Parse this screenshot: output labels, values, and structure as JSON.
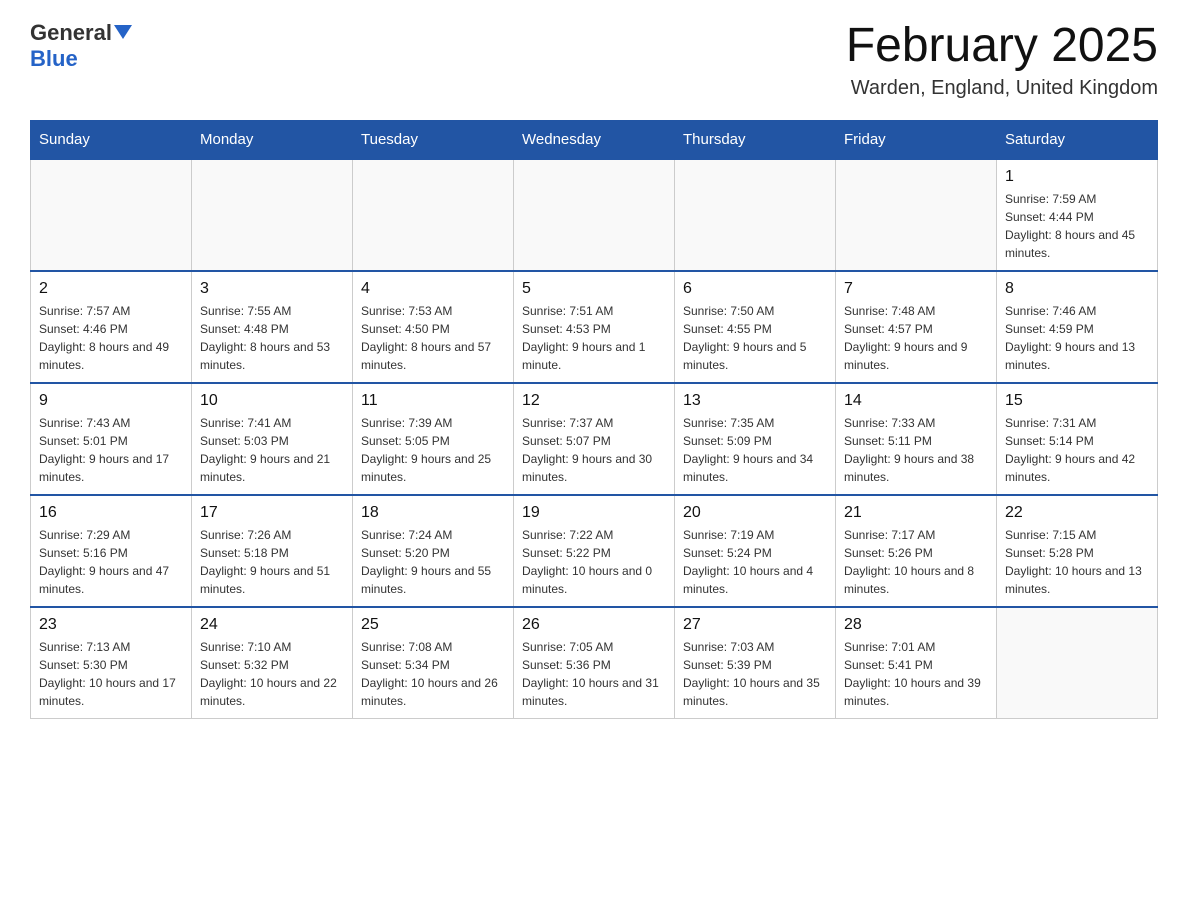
{
  "header": {
    "logo": {
      "general": "General",
      "blue": "Blue"
    },
    "title": "February 2025",
    "location": "Warden, England, United Kingdom"
  },
  "calendar": {
    "days_of_week": [
      "Sunday",
      "Monday",
      "Tuesday",
      "Wednesday",
      "Thursday",
      "Friday",
      "Saturday"
    ],
    "weeks": [
      [
        {
          "day": "",
          "info": ""
        },
        {
          "day": "",
          "info": ""
        },
        {
          "day": "",
          "info": ""
        },
        {
          "day": "",
          "info": ""
        },
        {
          "day": "",
          "info": ""
        },
        {
          "day": "",
          "info": ""
        },
        {
          "day": "1",
          "info": "Sunrise: 7:59 AM\nSunset: 4:44 PM\nDaylight: 8 hours and 45 minutes."
        }
      ],
      [
        {
          "day": "2",
          "info": "Sunrise: 7:57 AM\nSunset: 4:46 PM\nDaylight: 8 hours and 49 minutes."
        },
        {
          "day": "3",
          "info": "Sunrise: 7:55 AM\nSunset: 4:48 PM\nDaylight: 8 hours and 53 minutes."
        },
        {
          "day": "4",
          "info": "Sunrise: 7:53 AM\nSunset: 4:50 PM\nDaylight: 8 hours and 57 minutes."
        },
        {
          "day": "5",
          "info": "Sunrise: 7:51 AM\nSunset: 4:53 PM\nDaylight: 9 hours and 1 minute."
        },
        {
          "day": "6",
          "info": "Sunrise: 7:50 AM\nSunset: 4:55 PM\nDaylight: 9 hours and 5 minutes."
        },
        {
          "day": "7",
          "info": "Sunrise: 7:48 AM\nSunset: 4:57 PM\nDaylight: 9 hours and 9 minutes."
        },
        {
          "day": "8",
          "info": "Sunrise: 7:46 AM\nSunset: 4:59 PM\nDaylight: 9 hours and 13 minutes."
        }
      ],
      [
        {
          "day": "9",
          "info": "Sunrise: 7:43 AM\nSunset: 5:01 PM\nDaylight: 9 hours and 17 minutes."
        },
        {
          "day": "10",
          "info": "Sunrise: 7:41 AM\nSunset: 5:03 PM\nDaylight: 9 hours and 21 minutes."
        },
        {
          "day": "11",
          "info": "Sunrise: 7:39 AM\nSunset: 5:05 PM\nDaylight: 9 hours and 25 minutes."
        },
        {
          "day": "12",
          "info": "Sunrise: 7:37 AM\nSunset: 5:07 PM\nDaylight: 9 hours and 30 minutes."
        },
        {
          "day": "13",
          "info": "Sunrise: 7:35 AM\nSunset: 5:09 PM\nDaylight: 9 hours and 34 minutes."
        },
        {
          "day": "14",
          "info": "Sunrise: 7:33 AM\nSunset: 5:11 PM\nDaylight: 9 hours and 38 minutes."
        },
        {
          "day": "15",
          "info": "Sunrise: 7:31 AM\nSunset: 5:14 PM\nDaylight: 9 hours and 42 minutes."
        }
      ],
      [
        {
          "day": "16",
          "info": "Sunrise: 7:29 AM\nSunset: 5:16 PM\nDaylight: 9 hours and 47 minutes."
        },
        {
          "day": "17",
          "info": "Sunrise: 7:26 AM\nSunset: 5:18 PM\nDaylight: 9 hours and 51 minutes."
        },
        {
          "day": "18",
          "info": "Sunrise: 7:24 AM\nSunset: 5:20 PM\nDaylight: 9 hours and 55 minutes."
        },
        {
          "day": "19",
          "info": "Sunrise: 7:22 AM\nSunset: 5:22 PM\nDaylight: 10 hours and 0 minutes."
        },
        {
          "day": "20",
          "info": "Sunrise: 7:19 AM\nSunset: 5:24 PM\nDaylight: 10 hours and 4 minutes."
        },
        {
          "day": "21",
          "info": "Sunrise: 7:17 AM\nSunset: 5:26 PM\nDaylight: 10 hours and 8 minutes."
        },
        {
          "day": "22",
          "info": "Sunrise: 7:15 AM\nSunset: 5:28 PM\nDaylight: 10 hours and 13 minutes."
        }
      ],
      [
        {
          "day": "23",
          "info": "Sunrise: 7:13 AM\nSunset: 5:30 PM\nDaylight: 10 hours and 17 minutes."
        },
        {
          "day": "24",
          "info": "Sunrise: 7:10 AM\nSunset: 5:32 PM\nDaylight: 10 hours and 22 minutes."
        },
        {
          "day": "25",
          "info": "Sunrise: 7:08 AM\nSunset: 5:34 PM\nDaylight: 10 hours and 26 minutes."
        },
        {
          "day": "26",
          "info": "Sunrise: 7:05 AM\nSunset: 5:36 PM\nDaylight: 10 hours and 31 minutes."
        },
        {
          "day": "27",
          "info": "Sunrise: 7:03 AM\nSunset: 5:39 PM\nDaylight: 10 hours and 35 minutes."
        },
        {
          "day": "28",
          "info": "Sunrise: 7:01 AM\nSunset: 5:41 PM\nDaylight: 10 hours and 39 minutes."
        },
        {
          "day": "",
          "info": ""
        }
      ]
    ]
  }
}
